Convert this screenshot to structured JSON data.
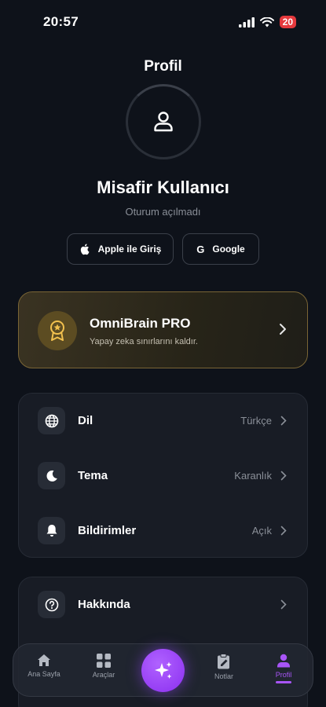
{
  "status_bar": {
    "time": "20:57",
    "battery": "20"
  },
  "header": {
    "title": "Profil"
  },
  "user": {
    "name": "Misafir Kullanıcı",
    "status": "Oturum açılmadı"
  },
  "login": {
    "apple_label": "Apple ile Giriş",
    "google_label": "Google",
    "google_glyph": "G"
  },
  "pro": {
    "title": "OmniBrain PRO",
    "subtitle": "Yapay zeka sınırlarını kaldır."
  },
  "settings": {
    "items": [
      {
        "label": "Dil",
        "value": "Türkçe",
        "icon": "globe-icon"
      },
      {
        "label": "Tema",
        "value": "Karanlık",
        "icon": "moon-icon"
      },
      {
        "label": "Bildirimler",
        "value": "Açık",
        "icon": "bell-icon"
      }
    ]
  },
  "about": {
    "items": [
      {
        "label": "Hakkında",
        "icon": "help-circle-icon"
      }
    ]
  },
  "tab_bar": {
    "tabs": [
      {
        "label": "Ana Sayfa",
        "icon": "home-icon"
      },
      {
        "label": "Araçlar",
        "icon": "grid-icon"
      },
      {
        "label": "Notlar",
        "icon": "notes-icon"
      },
      {
        "label": "Profil",
        "icon": "person-icon",
        "active": true
      }
    ],
    "center_icon": "sparkles-icon"
  },
  "colors": {
    "accent": "#a855f7",
    "pro_border": "#7a6535",
    "background": "#0e121a",
    "battery": "#e5393d"
  }
}
